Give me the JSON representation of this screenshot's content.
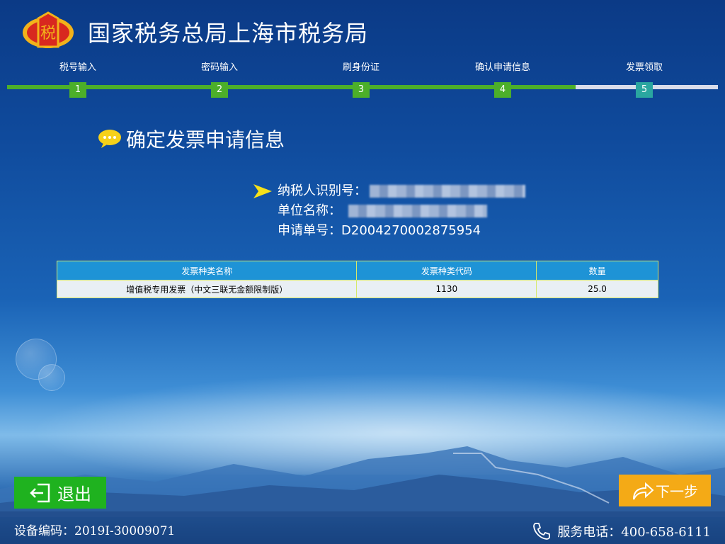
{
  "header": {
    "title": "国家税务总局上海市税务局"
  },
  "steps": [
    {
      "label": "税号输入",
      "num": "1"
    },
    {
      "label": "密码输入",
      "num": "2"
    },
    {
      "label": "刷身份证",
      "num": "3"
    },
    {
      "label": "确认申请信息",
      "num": "4"
    },
    {
      "label": "发票领取",
      "num": "5"
    }
  ],
  "section": {
    "title": "确定发票申请信息"
  },
  "info": {
    "taxpayer_id_label": "纳税人识别号：",
    "company_label": "单位名称：",
    "application_label": "申请单号：",
    "application_value": "D2004270002875954"
  },
  "table": {
    "headers": [
      "发票种类名称",
      "发票种类代码",
      "数量"
    ],
    "rows": [
      [
        "增值税专用发票（中文三联无金额限制版）",
        "1130",
        "25.0"
      ]
    ]
  },
  "buttons": {
    "exit": "退出",
    "next": "下一步"
  },
  "footer": {
    "device_code": "设备编码：2019I-30009071",
    "service_phone": "服务电话：400-658-6111"
  },
  "colors": {
    "accent_green": "#4caf2a",
    "next_orange": "#f4aa16",
    "table_header": "#1e93d6"
  }
}
